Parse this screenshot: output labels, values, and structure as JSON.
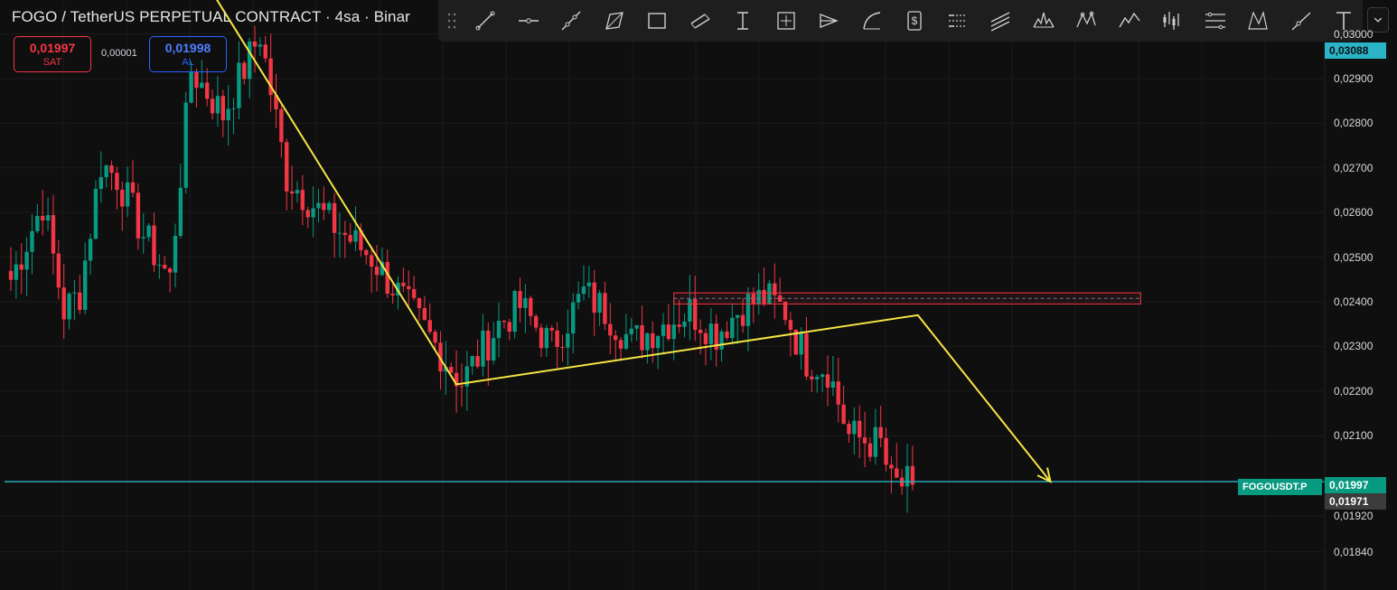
{
  "header": {
    "title": "FOGO / TetherUS PERPETUAL CONTRACT · 4sa · Binar"
  },
  "order_panel": {
    "sell_price": "0,01997",
    "sell_label": "SAT",
    "spread": "0,00001",
    "buy_price": "0,01998",
    "buy_label": "AL"
  },
  "toolbar": {
    "tools": [
      "trend-line-icon",
      "horizontal-ray-icon",
      "extended-line-icon",
      "pattern-icon",
      "rectangle-icon",
      "parallel-channel-icon",
      "price-range-icon",
      "date-price-range-icon",
      "pitchfork-icon",
      "curve-icon",
      "long-position-icon",
      "fib-retracement-icon",
      "regression-channel-icon",
      "head-shoulders-icon",
      "xabcd-pattern-icon",
      "elliott-wave-icon",
      "bars-pattern-icon",
      "gann-box-icon",
      "cypher-pattern-icon",
      "ray-icon",
      "text-icon"
    ]
  },
  "price_axis": {
    "top_tag": "0,03088",
    "ticks": [
      "0,03000",
      "0,02900",
      "0,02800",
      "0,02700",
      "0,02600",
      "0,02500",
      "0,02400",
      "0,02300",
      "0,02200",
      "0,02100",
      "0,01920",
      "0,01840"
    ],
    "symbol_tag": "FOGOUSDT.P",
    "current_price": "0,01997",
    "countdown_price": "0,01971"
  },
  "colors": {
    "background": "#0f0f0f",
    "up": "#089981",
    "down": "#f23645",
    "drawing": "#f5e642",
    "hline": "#2bb4c8",
    "zone": "#f23645"
  },
  "chart_data": {
    "type": "candlestick",
    "symbol": "FOGOUSDT.P",
    "timeframe": "4sa",
    "ylim": [
      0.0182,
      0.0312
    ],
    "horizontal_lines": [
      0.03088,
      0.01997
    ],
    "resistance_zone": [
      0.02395,
      0.0242
    ],
    "drawn_path": [
      {
        "bar": 35,
        "price": 0.0315
      },
      {
        "bar": 84,
        "price": 0.02215
      },
      {
        "bar": 171,
        "price": 0.0237
      },
      {
        "bar": 196,
        "price": 0.01997
      }
    ],
    "anchors": [
      [
        0,
        0.0245
      ],
      [
        6,
        0.0262
      ],
      [
        10,
        0.0238
      ],
      [
        13,
        0.0242
      ],
      [
        17,
        0.0271
      ],
      [
        20,
        0.0268
      ],
      [
        25,
        0.0255
      ],
      [
        30,
        0.0245
      ],
      [
        34,
        0.0292
      ],
      [
        40,
        0.0282
      ],
      [
        47,
        0.03
      ],
      [
        52,
        0.0268
      ],
      [
        60,
        0.0258
      ],
      [
        68,
        0.025
      ],
      [
        76,
        0.0237
      ],
      [
        85,
        0.0222
      ],
      [
        92,
        0.0235
      ],
      [
        96,
        0.0239
      ],
      [
        102,
        0.023
      ],
      [
        108,
        0.0242
      ],
      [
        112,
        0.0238
      ],
      [
        117,
        0.0231
      ],
      [
        123,
        0.0235
      ],
      [
        128,
        0.0238
      ],
      [
        133,
        0.0233
      ],
      [
        138,
        0.0239
      ],
      [
        142,
        0.0241
      ],
      [
        146,
        0.0238
      ],
      [
        148,
        0.0232
      ],
      [
        150,
        0.0227
      ],
      [
        154,
        0.0225
      ],
      [
        158,
        0.021
      ],
      [
        164,
        0.0208
      ],
      [
        166,
        0.0199
      ],
      [
        170,
        0.0199
      ]
    ]
  }
}
